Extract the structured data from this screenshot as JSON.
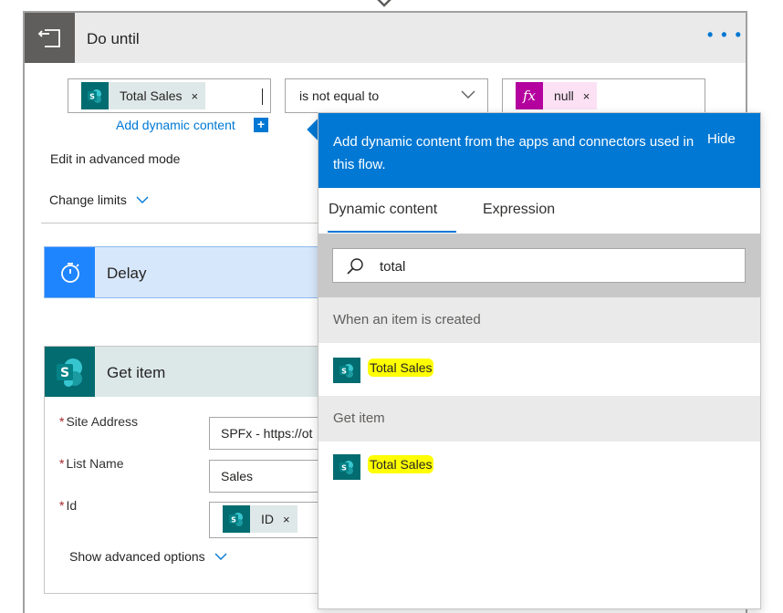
{
  "do_until": {
    "title": "Do until",
    "more_label": "• • •",
    "condition": {
      "left_token": "Total Sales",
      "operator": "is not equal to",
      "right_token": "null",
      "fx_label": "fx"
    },
    "add_dynamic_content": "Add dynamic content",
    "add_dynamic_plus": "+",
    "edit_advanced": "Edit in advanced mode",
    "change_limits": "Change limits"
  },
  "delay": {
    "title": "Delay"
  },
  "get_item": {
    "title": "Get item",
    "fields": [
      {
        "label": "Site Address",
        "value": "SPFx - https://ot"
      },
      {
        "label": "List Name",
        "value": "Sales"
      },
      {
        "label": "Id",
        "token": "ID"
      }
    ],
    "required_marker": "*",
    "show_advanced": "Show advanced options"
  },
  "dynamic_panel": {
    "header_text": "Add dynamic content from the apps and connectors used in this flow.",
    "hide_label": "Hide",
    "tabs": [
      "Dynamic content",
      "Expression"
    ],
    "active_tab": "Dynamic content",
    "search_value": "total",
    "groups": [
      {
        "label": "When an item is created",
        "items": [
          "Total Sales"
        ]
      },
      {
        "label": "Get item",
        "items": [
          "Total Sales"
        ]
      }
    ]
  },
  "token_remove": "×",
  "colors": {
    "accent": "#0078d4",
    "sharepoint": "#036c70",
    "expression": "#b4009e",
    "delay": "#1f85ff",
    "highlight": "#ffff00"
  }
}
